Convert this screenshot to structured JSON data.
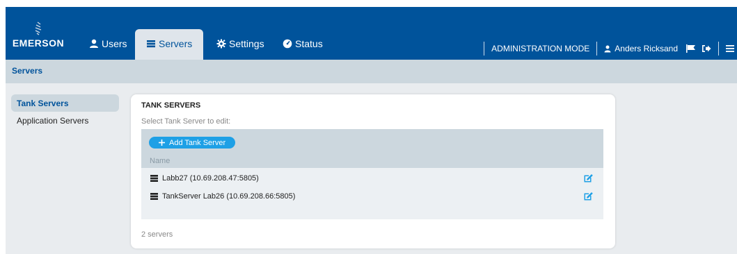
{
  "brand": {
    "name": "EMERSON"
  },
  "nav": [
    {
      "label": "Users",
      "icon": "user-icon"
    },
    {
      "label": "Servers",
      "icon": "server-icon",
      "active": true
    },
    {
      "label": "Settings",
      "icon": "gear-icon"
    },
    {
      "label": "Status",
      "icon": "dashboard-icon"
    }
  ],
  "header": {
    "mode": "ADMINISTRATION MODE",
    "user": "Anders Ricksand"
  },
  "breadcrumb": "Servers",
  "sidebar": {
    "items": [
      {
        "label": "Tank Servers",
        "active": true
      },
      {
        "label": "Application Servers"
      }
    ]
  },
  "panel": {
    "title": "TANK SERVERS",
    "subtitle": "Select Tank Server to edit:",
    "add_button": "Add Tank Server",
    "column": "Name",
    "rows": [
      {
        "name": "Labb27 (10.69.208.47:5805)"
      },
      {
        "name": "TankServer Lab26 (10.69.208.66:5805)"
      }
    ],
    "footer": "2 servers"
  },
  "colors": {
    "brand_blue": "#00539b",
    "accent_blue": "#1ea0e6",
    "light_gray_blue": "#ccd7de"
  }
}
